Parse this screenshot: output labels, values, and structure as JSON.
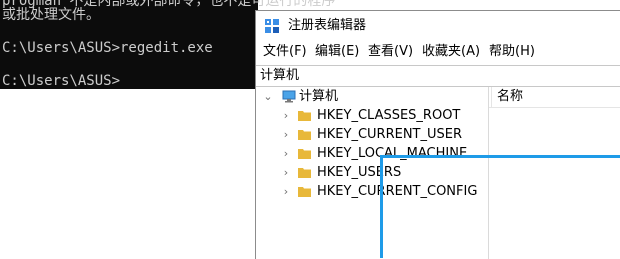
{
  "cmd": {
    "lines": [
      "progman 不是内部或外部命令，也不是可运行的程序",
      "或批处理文件。",
      "C:\\Users\\ASUS>regedit.exe",
      "C:\\Users\\ASUS>"
    ]
  },
  "regedit": {
    "title": "注册表编辑器",
    "menu": [
      "文件(F)",
      "编辑(E)",
      "查看(V)",
      "收藏夹(A)",
      "帮助(H)"
    ],
    "address": "计算机",
    "tree": {
      "root": "计算机",
      "keys": [
        "HKEY_CLASSES_ROOT",
        "HKEY_CURRENT_USER",
        "HKEY_LOCAL_MACHINE",
        "HKEY_USERS",
        "HKEY_CURRENT_CONFIG"
      ]
    },
    "list": {
      "column_name": "名称"
    }
  },
  "colors": {
    "highlight": "#1e9be8",
    "cmd_bg": "#0c0c0c",
    "folder": "#e8b83a"
  },
  "icons": [
    "regedit-app-icon",
    "computer-icon",
    "folder-icon",
    "chevron-right-icon",
    "chevron-down-icon"
  ]
}
